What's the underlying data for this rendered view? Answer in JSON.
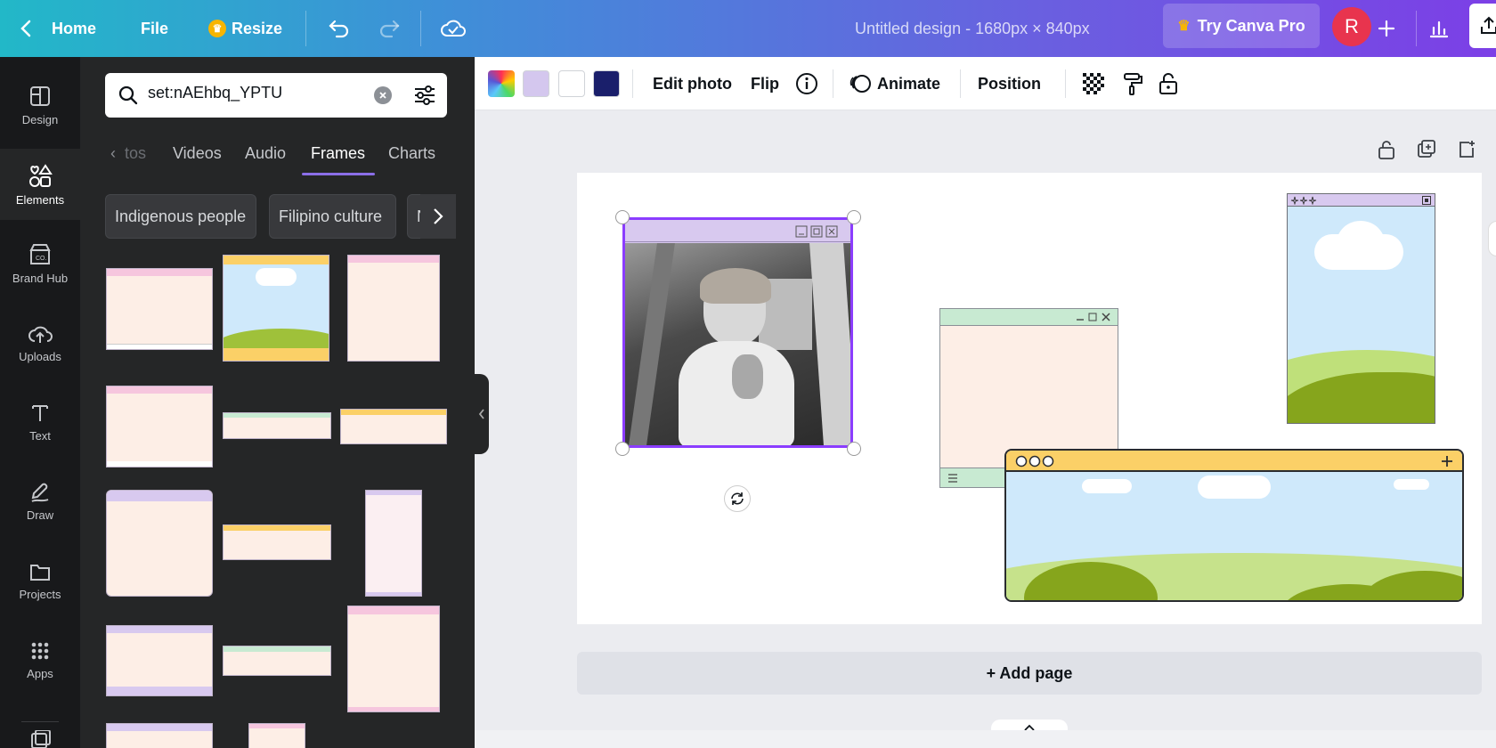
{
  "topbar": {
    "home_label": "Home",
    "file_label": "File",
    "resize_label": "Resize",
    "doc_title": "Untitled design - 1680px × 840px",
    "try_pro_label": "Try Canva Pro",
    "avatar_initial": "R"
  },
  "rail": {
    "items": [
      {
        "label": "Design",
        "icon": "design-icon"
      },
      {
        "label": "Elements",
        "icon": "elements-icon"
      },
      {
        "label": "Brand Hub",
        "icon": "brand-hub-icon"
      },
      {
        "label": "Uploads",
        "icon": "uploads-icon"
      },
      {
        "label": "Text",
        "icon": "text-icon"
      },
      {
        "label": "Draw",
        "icon": "draw-icon"
      },
      {
        "label": "Projects",
        "icon": "projects-icon"
      },
      {
        "label": "Apps",
        "icon": "apps-icon"
      }
    ],
    "active": "Elements"
  },
  "panel": {
    "search_value": "set:nAEhbq_YPTU",
    "tabs": [
      "tos",
      "Videos",
      "Audio",
      "Frames",
      "Charts"
    ],
    "active_tab": "Frames",
    "chips": [
      "Indigenous people",
      "Filipino culture",
      "Nat"
    ]
  },
  "toolbar": {
    "swatches": [
      "#f1e7ff",
      "#d4c7ee",
      "#ffffff",
      "#1a1f6b"
    ],
    "edit_photo_label": "Edit photo",
    "flip_label": "Flip",
    "animate_label": "Animate",
    "position_label": "Position"
  },
  "canvas": {
    "add_page_label": "+ Add page",
    "selection_color": "#8b3dff"
  },
  "colors": {
    "frame_lavender": "#d8c9ef",
    "frame_mint": "#c8ead2",
    "frame_yellow": "#fbd067",
    "frame_pink": "#f6c6de",
    "frame_body": "#fdeee6",
    "sky": "#cfe9fb",
    "grass": "#86a51c"
  }
}
